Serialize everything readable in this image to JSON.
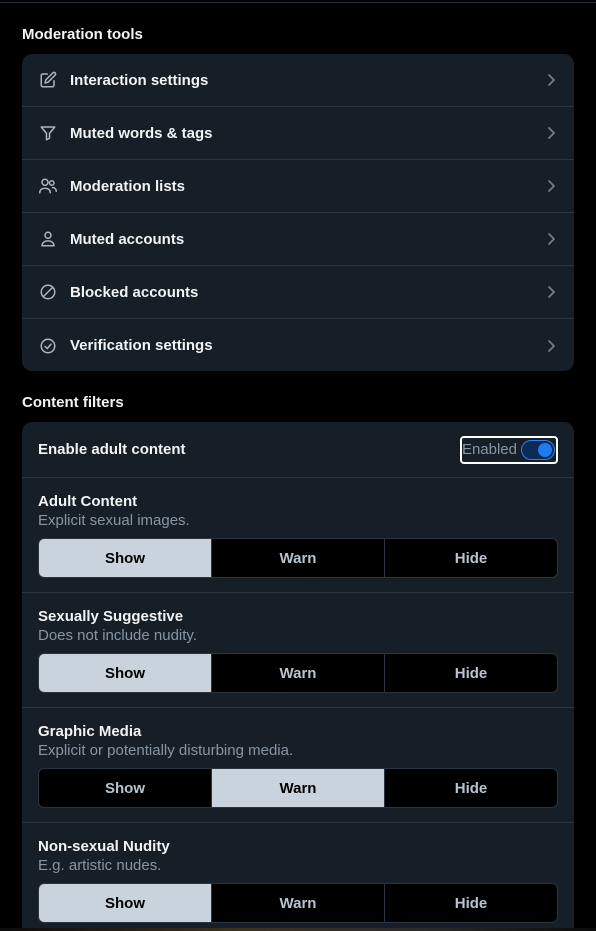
{
  "moderation": {
    "title": "Moderation tools",
    "items": [
      {
        "label": "Interaction settings"
      },
      {
        "label": "Muted words & tags"
      },
      {
        "label": "Moderation lists"
      },
      {
        "label": "Muted accounts"
      },
      {
        "label": "Blocked accounts"
      },
      {
        "label": "Verification settings"
      }
    ]
  },
  "content_filters": {
    "title": "Content filters",
    "adult_toggle": {
      "label": "Enable adult content",
      "state_label": "Enabled",
      "enabled": true
    },
    "options": [
      "Show",
      "Warn",
      "Hide"
    ],
    "filters": [
      {
        "title": "Adult Content",
        "description": "Explicit sexual images.",
        "selected": "Show"
      },
      {
        "title": "Sexually Suggestive",
        "description": "Does not include nudity.",
        "selected": "Show"
      },
      {
        "title": "Graphic Media",
        "description": "Explicit or potentially disturbing media.",
        "selected": "Warn"
      },
      {
        "title": "Non-sexual Nudity",
        "description": "E.g. artistic nudes.",
        "selected": "Show"
      }
    ]
  },
  "icons": [
    "edit-icon",
    "filter-icon",
    "users-icon",
    "user-icon",
    "block-icon",
    "check-circle-icon",
    "chevron-right-icon"
  ],
  "colors": {
    "background": "#000000",
    "card": "#161e27",
    "divider": "#2a3541",
    "muted_text": "#8796a5",
    "selected_segment": "#c8d3dd",
    "accent": "#1f7bf2"
  }
}
